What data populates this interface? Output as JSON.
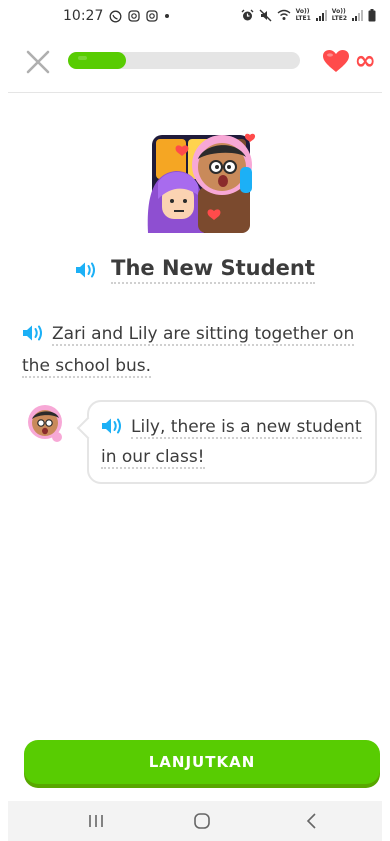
{
  "status_bar": {
    "time": "10:27",
    "net1": {
      "top": "Vo))",
      "bottom": "LTE1"
    },
    "net2": {
      "top": "Vo))",
      "bottom": "LTE2"
    }
  },
  "header": {
    "progress_percent": 25,
    "hearts_value": "∞"
  },
  "story": {
    "title": "The New Student",
    "narration": "Zari and Lily are sitting together on the school bus.",
    "dialog_line": "Lily, there is a new student in our class!"
  },
  "continue_label": "LANJUTKAN",
  "colors": {
    "accent_green": "#58cc02",
    "heart_red": "#ff4b4b",
    "speaker_blue": "#1cb0f6"
  },
  "icons": [
    "close-icon",
    "heart-icon",
    "speaker-icon",
    "recent-apps-icon",
    "home-icon",
    "back-icon"
  ]
}
